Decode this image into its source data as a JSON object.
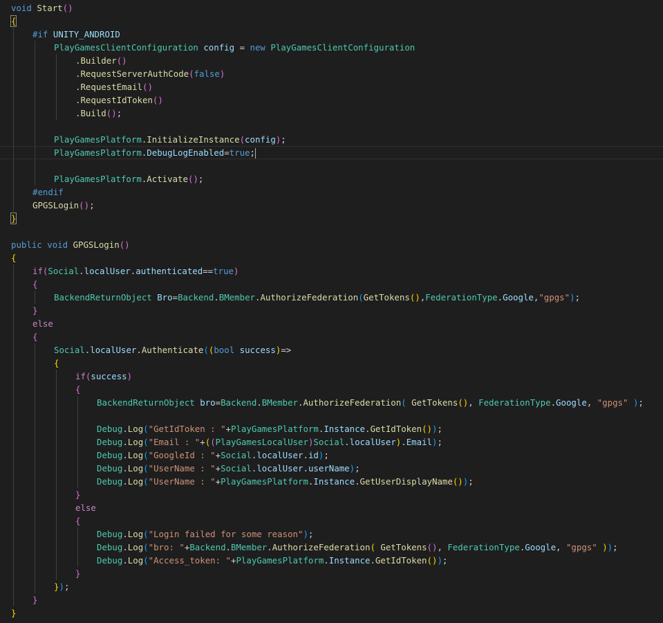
{
  "editor": {
    "colors": {
      "background": "#1e1e1e",
      "keyword": "#569cd6",
      "control": "#c586c0",
      "type": "#4ec9b0",
      "function": "#dcdcaa",
      "variable": "#9cdcfe",
      "string": "#ce9178",
      "text": "#d4d4d4",
      "bracket1": "#ffd700",
      "bracket2": "#da70d6",
      "bracket3": "#179fff"
    },
    "lines": [
      {
        "indent": 0,
        "tokens": [
          [
            "void",
            "k"
          ],
          [
            " ",
            "t"
          ],
          [
            "Start",
            "f"
          ],
          [
            "()",
            "b2"
          ]
        ]
      },
      {
        "indent": 0,
        "tokens": [
          [
            "{",
            "b1"
          ]
        ],
        "match": true
      },
      {
        "indent": 1,
        "tokens": [
          [
            "#if",
            "k"
          ],
          [
            " ",
            "t"
          ],
          [
            "UNITY_ANDROID",
            "v"
          ]
        ]
      },
      {
        "indent": 2,
        "tokens": [
          [
            "PlayGamesClientConfiguration",
            "ty"
          ],
          [
            " ",
            "t"
          ],
          [
            "config",
            "v"
          ],
          [
            " = ",
            "t"
          ],
          [
            "new",
            "k"
          ],
          [
            " ",
            "t"
          ],
          [
            "PlayGamesClientConfiguration",
            "ty"
          ]
        ]
      },
      {
        "indent": 3,
        "tokens": [
          [
            ".",
            "t"
          ],
          [
            "Builder",
            "f"
          ],
          [
            "()",
            "b2"
          ]
        ]
      },
      {
        "indent": 3,
        "tokens": [
          [
            ".",
            "t"
          ],
          [
            "RequestServerAuthCode",
            "f"
          ],
          [
            "(",
            "b2"
          ],
          [
            "false",
            "k"
          ],
          [
            ")",
            "b2"
          ]
        ]
      },
      {
        "indent": 3,
        "tokens": [
          [
            ".",
            "t"
          ],
          [
            "RequestEmail",
            "f"
          ],
          [
            "()",
            "b2"
          ]
        ]
      },
      {
        "indent": 3,
        "tokens": [
          [
            ".",
            "t"
          ],
          [
            "RequestIdToken",
            "f"
          ],
          [
            "()",
            "b2"
          ]
        ]
      },
      {
        "indent": 3,
        "tokens": [
          [
            ".",
            "t"
          ],
          [
            "Build",
            "f"
          ],
          [
            "()",
            "b2"
          ],
          [
            ";",
            "t"
          ]
        ]
      },
      {
        "indent": 0,
        "tokens": []
      },
      {
        "indent": 2,
        "tokens": [
          [
            "PlayGamesPlatform",
            "ty"
          ],
          [
            ".",
            "t"
          ],
          [
            "InitializeInstance",
            "f"
          ],
          [
            "(",
            "b2"
          ],
          [
            "config",
            "v"
          ],
          [
            ")",
            "b2"
          ],
          [
            ";",
            "t"
          ]
        ]
      },
      {
        "indent": 2,
        "tokens": [
          [
            "PlayGamesPlatform",
            "ty"
          ],
          [
            ".",
            "t"
          ],
          [
            "DebugLogEnabled",
            "v"
          ],
          [
            "=",
            "t"
          ],
          [
            "true",
            "k"
          ],
          [
            ";",
            "t"
          ]
        ],
        "current": true,
        "caret": true
      },
      {
        "indent": 0,
        "tokens": []
      },
      {
        "indent": 2,
        "tokens": [
          [
            "PlayGamesPlatform",
            "ty"
          ],
          [
            ".",
            "t"
          ],
          [
            "Activate",
            "f"
          ],
          [
            "()",
            "b2"
          ],
          [
            ";",
            "t"
          ]
        ]
      },
      {
        "indent": 1,
        "tokens": [
          [
            "#endif",
            "k"
          ]
        ]
      },
      {
        "indent": 1,
        "tokens": [
          [
            "GPGSLogin",
            "f"
          ],
          [
            "()",
            "b2"
          ],
          [
            ";",
            "t"
          ]
        ]
      },
      {
        "indent": 0,
        "tokens": [
          [
            "}",
            "b1"
          ]
        ],
        "match": true
      },
      {
        "indent": 0,
        "tokens": []
      },
      {
        "indent": 0,
        "tokens": [
          [
            "public",
            "k"
          ],
          [
            " ",
            "t"
          ],
          [
            "void",
            "k"
          ],
          [
            " ",
            "t"
          ],
          [
            "GPGSLogin",
            "f"
          ],
          [
            "()",
            "b2"
          ]
        ]
      },
      {
        "indent": 0,
        "tokens": [
          [
            "{",
            "b1"
          ]
        ]
      },
      {
        "indent": 1,
        "tokens": [
          [
            "if",
            "c"
          ],
          [
            "(",
            "b2"
          ],
          [
            "Social",
            "ty"
          ],
          [
            ".",
            "t"
          ],
          [
            "localUser",
            "v"
          ],
          [
            ".",
            "t"
          ],
          [
            "authenticated",
            "v"
          ],
          [
            "==",
            "t"
          ],
          [
            "true",
            "k"
          ],
          [
            ")",
            "b2"
          ]
        ]
      },
      {
        "indent": 1,
        "tokens": [
          [
            "{",
            "b2"
          ]
        ]
      },
      {
        "indent": 2,
        "tokens": [
          [
            "BackendReturnObject",
            "ty"
          ],
          [
            " ",
            "t"
          ],
          [
            "Bro",
            "v"
          ],
          [
            "=",
            "t"
          ],
          [
            "Backend",
            "ty"
          ],
          [
            ".",
            "t"
          ],
          [
            "BMember",
            "ty"
          ],
          [
            ".",
            "t"
          ],
          [
            "AuthorizeFederation",
            "f"
          ],
          [
            "(",
            "b3"
          ],
          [
            "GetTokens",
            "f"
          ],
          [
            "()",
            "b1"
          ],
          [
            ",",
            "t"
          ],
          [
            "FederationType",
            "ty"
          ],
          [
            ".",
            "t"
          ],
          [
            "Google",
            "v"
          ],
          [
            ",",
            "t"
          ],
          [
            "\"gpgs\"",
            "s"
          ],
          [
            ")",
            "b3"
          ],
          [
            ";",
            "t"
          ]
        ]
      },
      {
        "indent": 1,
        "tokens": [
          [
            "}",
            "b2"
          ]
        ]
      },
      {
        "indent": 1,
        "tokens": [
          [
            "else",
            "c"
          ]
        ]
      },
      {
        "indent": 1,
        "tokens": [
          [
            "{",
            "b2"
          ]
        ]
      },
      {
        "indent": 2,
        "tokens": [
          [
            "Social",
            "ty"
          ],
          [
            ".",
            "t"
          ],
          [
            "localUser",
            "v"
          ],
          [
            ".",
            "t"
          ],
          [
            "Authenticate",
            "f"
          ],
          [
            "(",
            "b3"
          ],
          [
            "(",
            "b1"
          ],
          [
            "bool",
            "k"
          ],
          [
            " ",
            "t"
          ],
          [
            "success",
            "v"
          ],
          [
            ")",
            "b1"
          ],
          [
            "=>",
            "t"
          ]
        ]
      },
      {
        "indent": 2,
        "tokens": [
          [
            "{",
            "b1"
          ]
        ]
      },
      {
        "indent": 3,
        "tokens": [
          [
            "if",
            "c"
          ],
          [
            "(",
            "b2"
          ],
          [
            "success",
            "v"
          ],
          [
            ")",
            "b2"
          ]
        ]
      },
      {
        "indent": 3,
        "tokens": [
          [
            "{",
            "b2"
          ]
        ]
      },
      {
        "indent": 4,
        "tokens": [
          [
            "BackendReturnObject",
            "ty"
          ],
          [
            " ",
            "t"
          ],
          [
            "bro",
            "v"
          ],
          [
            "=",
            "t"
          ],
          [
            "Backend",
            "ty"
          ],
          [
            ".",
            "t"
          ],
          [
            "BMember",
            "ty"
          ],
          [
            ".",
            "t"
          ],
          [
            "AuthorizeFederation",
            "f"
          ],
          [
            "(",
            "b3"
          ],
          [
            " ",
            "t"
          ],
          [
            "GetTokens",
            "f"
          ],
          [
            "()",
            "b1"
          ],
          [
            ", ",
            "t"
          ],
          [
            "FederationType",
            "ty"
          ],
          [
            ".",
            "t"
          ],
          [
            "Google",
            "v"
          ],
          [
            ", ",
            "t"
          ],
          [
            "\"gpgs\"",
            "s"
          ],
          [
            " ",
            "t"
          ],
          [
            ")",
            "b3"
          ],
          [
            ";",
            "t"
          ]
        ]
      },
      {
        "indent": 0,
        "tokens": []
      },
      {
        "indent": 4,
        "tokens": [
          [
            "Debug",
            "ty"
          ],
          [
            ".",
            "t"
          ],
          [
            "Log",
            "f"
          ],
          [
            "(",
            "b3"
          ],
          [
            "\"GetIdToken : \"",
            "s"
          ],
          [
            "+",
            "t"
          ],
          [
            "PlayGamesPlatform",
            "ty"
          ],
          [
            ".",
            "t"
          ],
          [
            "Instance",
            "v"
          ],
          [
            ".",
            "t"
          ],
          [
            "GetIdToken",
            "f"
          ],
          [
            "()",
            "b1"
          ],
          [
            ")",
            "b3"
          ],
          [
            ";",
            "t"
          ]
        ]
      },
      {
        "indent": 4,
        "tokens": [
          [
            "Debug",
            "ty"
          ],
          [
            ".",
            "t"
          ],
          [
            "Log",
            "f"
          ],
          [
            "(",
            "b3"
          ],
          [
            "\"Email : \"",
            "s"
          ],
          [
            "+",
            "t"
          ],
          [
            "(",
            "b1"
          ],
          [
            "(",
            "b2"
          ],
          [
            "PlayGamesLocalUser",
            "ty"
          ],
          [
            ")",
            "b2"
          ],
          [
            "Social",
            "ty"
          ],
          [
            ".",
            "t"
          ],
          [
            "localUser",
            "v"
          ],
          [
            ")",
            "b1"
          ],
          [
            ".",
            "t"
          ],
          [
            "Email",
            "v"
          ],
          [
            ")",
            "b3"
          ],
          [
            ";",
            "t"
          ]
        ]
      },
      {
        "indent": 4,
        "tokens": [
          [
            "Debug",
            "ty"
          ],
          [
            ".",
            "t"
          ],
          [
            "Log",
            "f"
          ],
          [
            "(",
            "b3"
          ],
          [
            "\"GoogleId : \"",
            "s"
          ],
          [
            "+",
            "t"
          ],
          [
            "Social",
            "ty"
          ],
          [
            ".",
            "t"
          ],
          [
            "localUser",
            "v"
          ],
          [
            ".",
            "t"
          ],
          [
            "id",
            "v"
          ],
          [
            ")",
            "b3"
          ],
          [
            ";",
            "t"
          ]
        ]
      },
      {
        "indent": 4,
        "tokens": [
          [
            "Debug",
            "ty"
          ],
          [
            ".",
            "t"
          ],
          [
            "Log",
            "f"
          ],
          [
            "(",
            "b3"
          ],
          [
            "\"UserName : \"",
            "s"
          ],
          [
            "+",
            "t"
          ],
          [
            "Social",
            "ty"
          ],
          [
            ".",
            "t"
          ],
          [
            "localUser",
            "v"
          ],
          [
            ".",
            "t"
          ],
          [
            "userName",
            "v"
          ],
          [
            ")",
            "b3"
          ],
          [
            ";",
            "t"
          ]
        ]
      },
      {
        "indent": 4,
        "tokens": [
          [
            "Debug",
            "ty"
          ],
          [
            ".",
            "t"
          ],
          [
            "Log",
            "f"
          ],
          [
            "(",
            "b3"
          ],
          [
            "\"UserName : \"",
            "s"
          ],
          [
            "+",
            "t"
          ],
          [
            "PlayGamesPlatform",
            "ty"
          ],
          [
            ".",
            "t"
          ],
          [
            "Instance",
            "v"
          ],
          [
            ".",
            "t"
          ],
          [
            "GetUserDisplayName",
            "f"
          ],
          [
            "()",
            "b1"
          ],
          [
            ")",
            "b3"
          ],
          [
            ";",
            "t"
          ]
        ]
      },
      {
        "indent": 3,
        "tokens": [
          [
            "}",
            "b2"
          ]
        ]
      },
      {
        "indent": 3,
        "tokens": [
          [
            "else",
            "c"
          ]
        ]
      },
      {
        "indent": 3,
        "tokens": [
          [
            "{",
            "b2"
          ]
        ]
      },
      {
        "indent": 4,
        "tokens": [
          [
            "Debug",
            "ty"
          ],
          [
            ".",
            "t"
          ],
          [
            "Log",
            "f"
          ],
          [
            "(",
            "b3"
          ],
          [
            "\"Login failed for some reason\"",
            "s"
          ],
          [
            ")",
            "b3"
          ],
          [
            ";",
            "t"
          ]
        ]
      },
      {
        "indent": 4,
        "tokens": [
          [
            "Debug",
            "ty"
          ],
          [
            ".",
            "t"
          ],
          [
            "Log",
            "f"
          ],
          [
            "(",
            "b3"
          ],
          [
            "\"bro: \"",
            "s"
          ],
          [
            "+",
            "t"
          ],
          [
            "Backend",
            "ty"
          ],
          [
            ".",
            "t"
          ],
          [
            "BMember",
            "ty"
          ],
          [
            ".",
            "t"
          ],
          [
            "AuthorizeFederation",
            "f"
          ],
          [
            "(",
            "b1"
          ],
          [
            " ",
            "t"
          ],
          [
            "GetTokens",
            "f"
          ],
          [
            "()",
            "b2"
          ],
          [
            ", ",
            "t"
          ],
          [
            "FederationType",
            "ty"
          ],
          [
            ".",
            "t"
          ],
          [
            "Google",
            "v"
          ],
          [
            ", ",
            "t"
          ],
          [
            "\"gpgs\"",
            "s"
          ],
          [
            " ",
            "t"
          ],
          [
            ")",
            "b1"
          ],
          [
            ")",
            "b3"
          ],
          [
            ";",
            "t"
          ]
        ]
      },
      {
        "indent": 4,
        "tokens": [
          [
            "Debug",
            "ty"
          ],
          [
            ".",
            "t"
          ],
          [
            "Log",
            "f"
          ],
          [
            "(",
            "b3"
          ],
          [
            "\"Access_token: \"",
            "s"
          ],
          [
            "+",
            "t"
          ],
          [
            "PlayGamesPlatform",
            "ty"
          ],
          [
            ".",
            "t"
          ],
          [
            "Instance",
            "v"
          ],
          [
            ".",
            "t"
          ],
          [
            "GetIdToken",
            "f"
          ],
          [
            "()",
            "b1"
          ],
          [
            ")",
            "b3"
          ],
          [
            ";",
            "t"
          ]
        ]
      },
      {
        "indent": 3,
        "tokens": [
          [
            "}",
            "b2"
          ]
        ]
      },
      {
        "indent": 2,
        "tokens": [
          [
            "}",
            "b1"
          ],
          [
            ")",
            "b3"
          ],
          [
            ";",
            "t"
          ]
        ]
      },
      {
        "indent": 1,
        "tokens": [
          [
            "}",
            "b2"
          ]
        ]
      },
      {
        "indent": 0,
        "tokens": [
          [
            "}",
            "b1"
          ]
        ]
      }
    ]
  }
}
